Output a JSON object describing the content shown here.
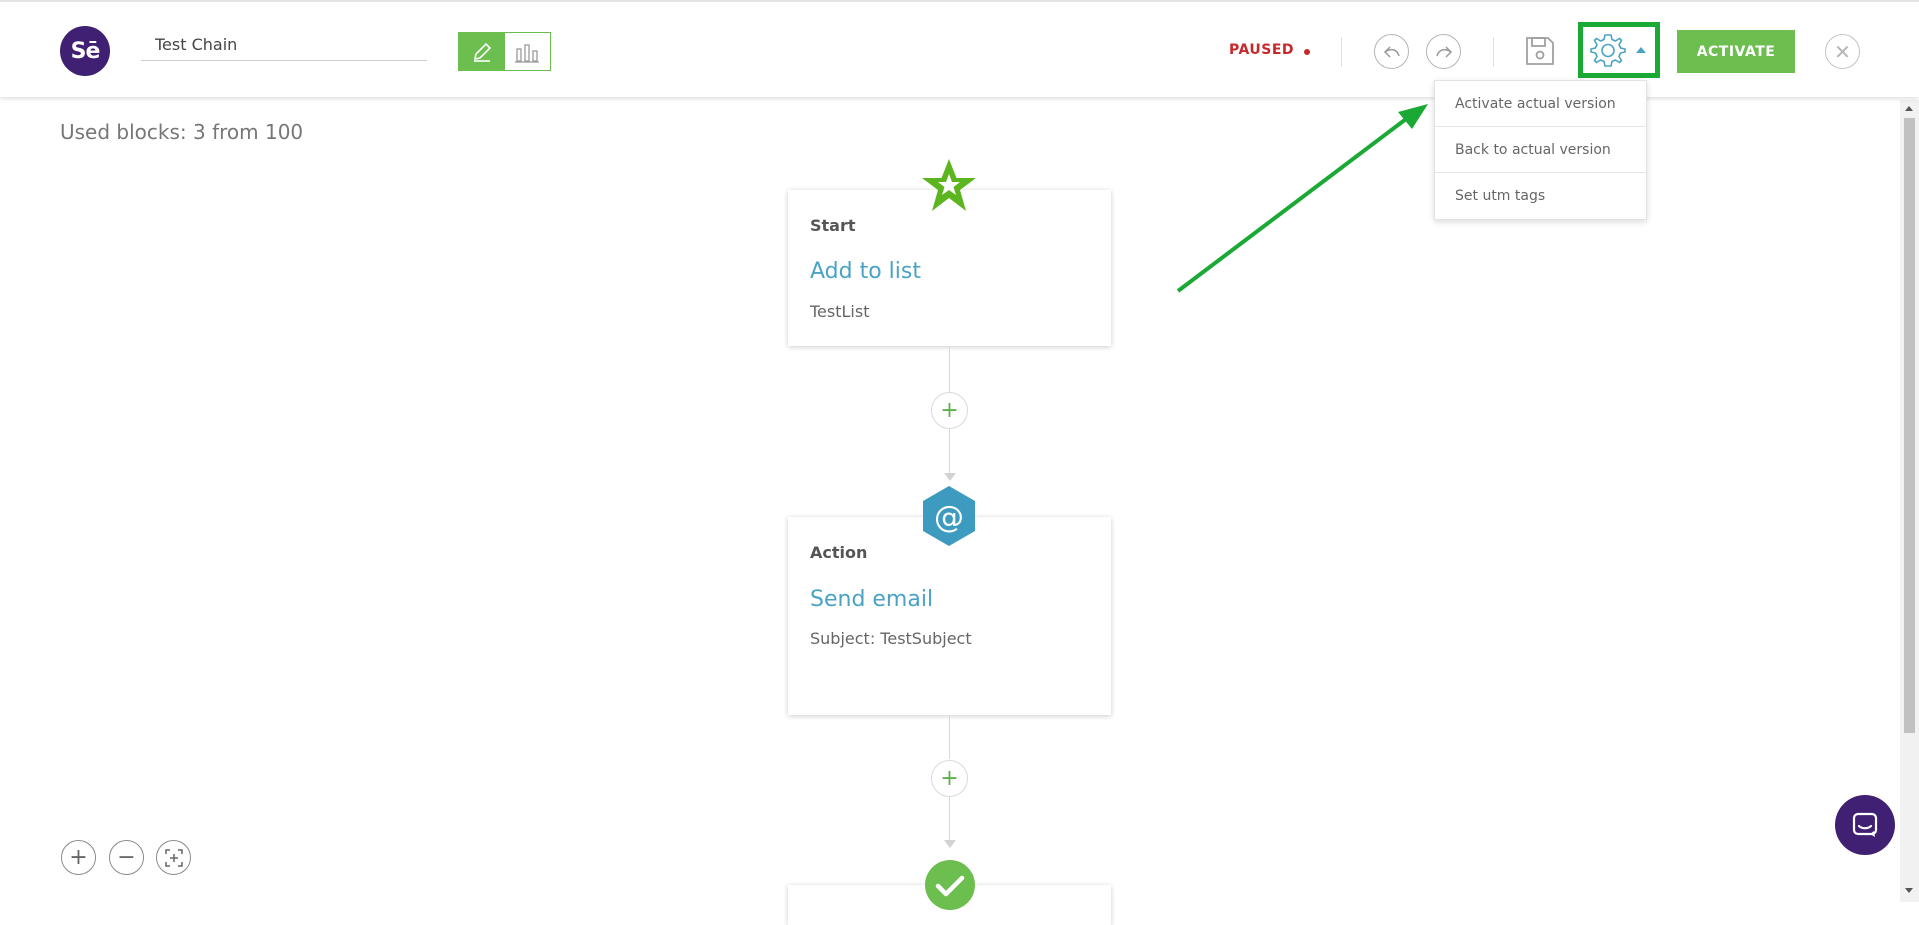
{
  "app": {
    "logo_text": "Sē"
  },
  "header": {
    "chain_name": "Test Chain",
    "status": "PAUSED",
    "activate_label": "ACTIVATE",
    "close_symbol": "✕"
  },
  "settings_menu": {
    "items": [
      {
        "label": "Activate actual version"
      },
      {
        "label": "Back to actual version"
      },
      {
        "label": "Set utm tags"
      }
    ]
  },
  "canvas": {
    "used_blocks": "Used blocks: 3 from 100",
    "blocks": [
      {
        "type": "Start",
        "title": "Add to list",
        "subtitle": "TestList",
        "icon": "star-icon"
      },
      {
        "type": "Action",
        "title": "Send email",
        "subtitle": "Subject: TestSubject",
        "icon": "at-icon"
      },
      {
        "icon": "check-icon"
      }
    ],
    "add_symbol": "+"
  },
  "zoom": {
    "in": "+",
    "out": "−"
  },
  "colors": {
    "brand": "#3f2073",
    "accent_green": "#6cbf4e",
    "link_blue": "#4aa3c4",
    "paused_red": "#c7282c",
    "annotation_green": "#1aa934"
  }
}
